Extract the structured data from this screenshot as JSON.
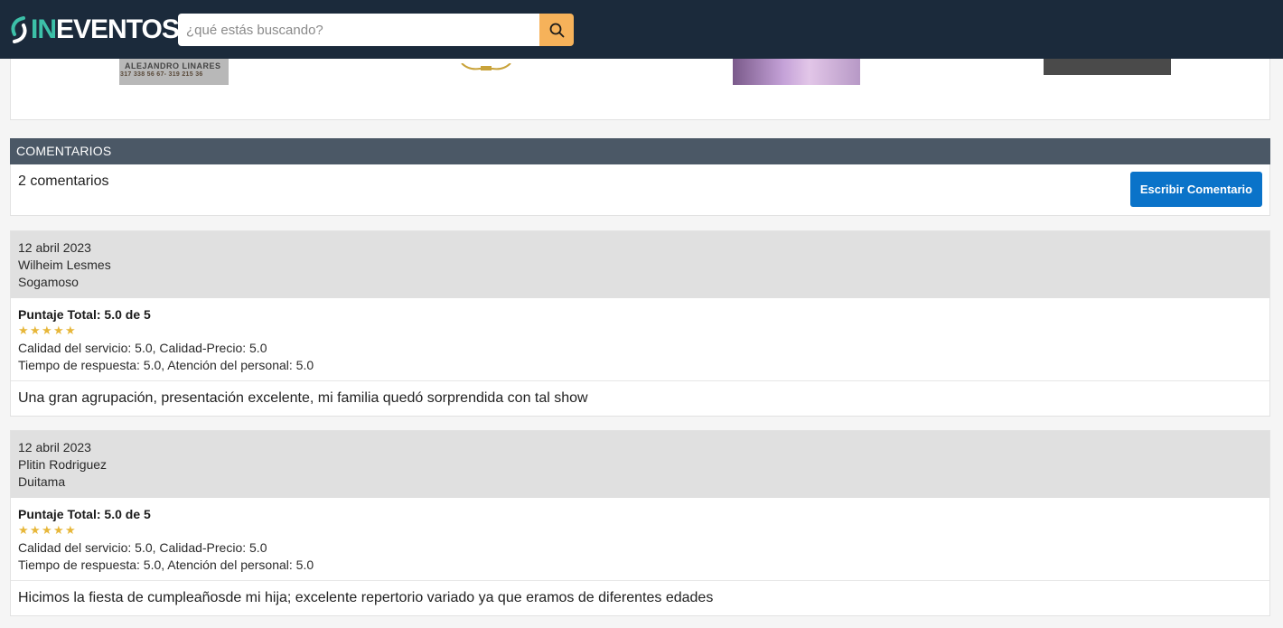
{
  "header": {
    "logo_in": "IN",
    "logo_eventos": "EVENTOS",
    "search_placeholder": "¿qué estás buscando?"
  },
  "gallery": {
    "thumb1_line1": "ALEJANDRO LINARES",
    "thumb1_line2": "317 338 56 67- 319 215 36"
  },
  "comments": {
    "section_title": "COMENTARIOS",
    "count_label": "2 comentarios",
    "write_button": "Escribir Comentario"
  },
  "reviews": [
    {
      "date": "12 abril 2023",
      "author": "Wilheim Lesmes",
      "city": "Sogamoso",
      "total": "Puntaje Total: 5.0 de 5",
      "rating": 5,
      "line1": "Calidad del servicio: 5.0, Calidad-Precio: 5.0",
      "line2": "Tiempo de respuesta: 5.0, Atención del personal: 5.0",
      "text": "Una gran agrupación, presentación excelente, mi familia quedó sorprendida con tal show"
    },
    {
      "date": "12 abril 2023",
      "author": "Plitin Rodriguez",
      "city": "Duitama",
      "total": "Puntaje Total: 5.0 de 5",
      "rating": 5,
      "line1": "Calidad del servicio: 5.0, Calidad-Precio: 5.0",
      "line2": "Tiempo de respuesta: 5.0, Atención del personal: 5.0",
      "text": "Hicimos la fiesta de cumpleañosde mi hija; excelente repertorio variado ya que eramos de diferentes edades"
    }
  ],
  "colors": {
    "header_bg": "#1b2a3b",
    "search_button": "#f6b25a",
    "section_header": "#4b5866",
    "primary_button": "#0a73c9",
    "star": "#e7b73a",
    "logo_accent": "#3cc0a8"
  }
}
